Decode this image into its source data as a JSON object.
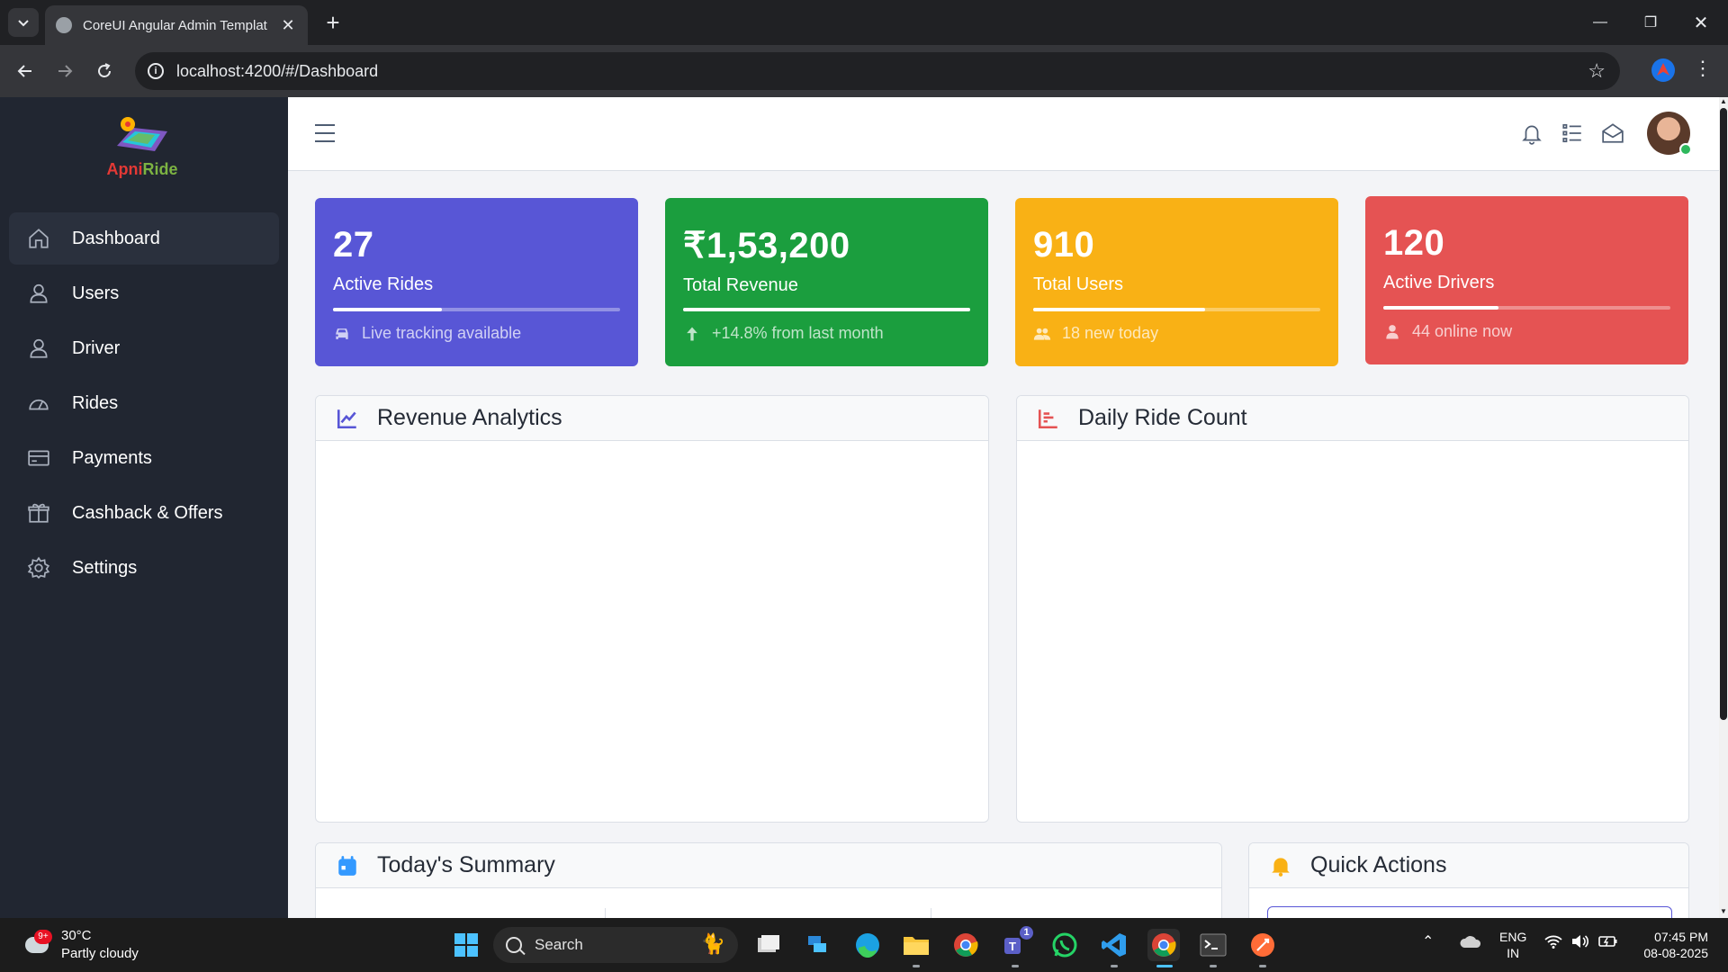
{
  "browser": {
    "tab_title": "CoreUI Angular Admin Templat",
    "url": "localhost:4200/#/Dashboard"
  },
  "sidebar": {
    "logo_text_a": "Apni",
    "logo_text_b": "Ride",
    "items": [
      {
        "label": "Dashboard",
        "icon": "home-icon",
        "active": true
      },
      {
        "label": "Users",
        "icon": "user-icon"
      },
      {
        "label": "Driver",
        "icon": "user-icon"
      },
      {
        "label": "Rides",
        "icon": "speedometer-icon"
      },
      {
        "label": "Payments",
        "icon": "credit-card-icon"
      },
      {
        "label": "Cashback & Offers",
        "icon": "gift-icon"
      },
      {
        "label": "Settings",
        "icon": "gear-icon"
      }
    ]
  },
  "stats": [
    {
      "value": "27",
      "label": "Active Rides",
      "sub": "Live tracking available",
      "icon": "car-icon",
      "color": "#5856d6",
      "progress": 0.38
    },
    {
      "value": "₹1,53,200",
      "label": "Total Revenue",
      "sub": "+14.8% from last month",
      "icon": "arrow-up-icon",
      "color": "#1b9e3e",
      "progress": 1.0
    },
    {
      "value": "910",
      "label": "Total Users",
      "sub": "18 new today",
      "icon": "users-icon",
      "color": "#f9b115",
      "progress": 0.6
    },
    {
      "value": "120",
      "label": "Active Drivers",
      "sub": "44 online now",
      "icon": "person-icon",
      "color": "#e55353",
      "progress": 0.4
    }
  ],
  "panels": {
    "revenue_title": "Revenue Analytics",
    "rides_title": "Daily Ride Count",
    "summary_title": "Today's Summary",
    "actions_title": "Quick Actions"
  },
  "taskbar": {
    "temp": "30°C",
    "weather": "Partly cloudy",
    "weather_badge": "9+",
    "search_label": "Search",
    "teams_badge": "1",
    "lang_1": "ENG",
    "lang_2": "IN",
    "time": "07:45 PM",
    "date": "08-08-2025"
  }
}
